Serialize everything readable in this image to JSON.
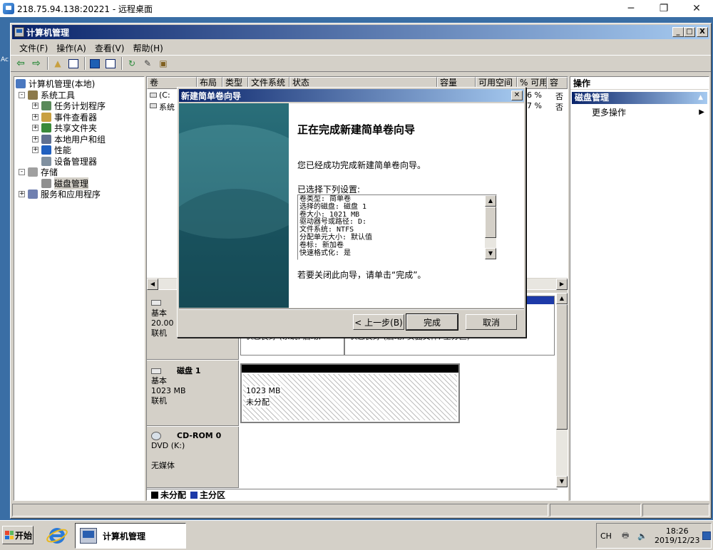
{
  "rdp": {
    "title": "218.75.94.138:20221 - 远程桌面",
    "minimize": "─",
    "maximize": "❐",
    "close": "✕",
    "desktop_label": "Ac"
  },
  "mmc": {
    "title": "计算机管理",
    "title_buttons": {
      "min": "_",
      "max": "□",
      "close": "X"
    },
    "menus": [
      "文件(F)",
      "操作(A)",
      "查看(V)",
      "帮助(H)"
    ],
    "toolbar_icons": [
      "back-arrow-icon",
      "forward-arrow-icon",
      "up-folder-icon",
      "show-hide-tree-icon",
      "help-icon",
      "properties-icon",
      "refresh-icon",
      "export-icon",
      "disk-icon"
    ]
  },
  "tree": [
    {
      "label": "计算机管理(本地)",
      "level": 0,
      "exp": "",
      "icon": "computer-icon",
      "color": "#4a78c0"
    },
    {
      "label": "系统工具",
      "level": 1,
      "exp": "-",
      "icon": "tools-icon",
      "color": "#8c7a4a"
    },
    {
      "label": "任务计划程序",
      "level": 2,
      "exp": "+",
      "icon": "clock-icon",
      "color": "#5a8a5a"
    },
    {
      "label": "事件查看器",
      "level": 2,
      "exp": "+",
      "icon": "event-viewer-icon",
      "color": "#c8a040"
    },
    {
      "label": "共享文件夹",
      "level": 2,
      "exp": "+",
      "icon": "shared-folder-icon",
      "color": "#3a8a3a"
    },
    {
      "label": "本地用户和组",
      "level": 2,
      "exp": "+",
      "icon": "users-icon",
      "color": "#607090"
    },
    {
      "label": "性能",
      "level": 2,
      "exp": "+",
      "icon": "performance-icon",
      "color": "#2060c0"
    },
    {
      "label": "设备管理器",
      "level": 2,
      "exp": "",
      "icon": "device-manager-icon",
      "color": "#8090a0"
    },
    {
      "label": "存储",
      "level": 1,
      "exp": "-",
      "icon": "storage-icon",
      "color": "#a0a0a0"
    },
    {
      "label": "磁盘管理",
      "level": 2,
      "exp": "",
      "icon": "disk-management-icon",
      "color": "#909090",
      "selected": true
    },
    {
      "label": "服务和应用程序",
      "level": 1,
      "exp": "+",
      "icon": "services-icon",
      "color": "#7080b0"
    }
  ],
  "volume_list": {
    "columns": [
      "卷",
      "布局",
      "类型",
      "文件系统",
      "状态",
      "容量",
      "可用空间",
      "% 可用",
      "容"
    ],
    "rows": [
      {
        "vol": "(C:",
        "pct": "6 %",
        "fault": "否"
      },
      {
        "vol": "系统",
        "pct": "7 %",
        "fault": "否"
      }
    ]
  },
  "disks": [
    {
      "name": "",
      "type": "基本",
      "size": "20.00",
      "status": "联机",
      "partition_text_1": "状态良好 (系统, 启动,",
      "partition_text_2": "状态良好 (启动, 页面文件, 主分区)"
    },
    {
      "name": "磁盘 1",
      "type": "基本",
      "size": "1023 MB",
      "status": "联机",
      "partition_size": "1023 MB",
      "partition_state": "未分配"
    },
    {
      "name": "CD-ROM 0",
      "type": "DVD (K:)",
      "size": "",
      "status": "无媒体"
    }
  ],
  "legend": [
    {
      "label": "未分配",
      "color": "#000000"
    },
    {
      "label": "主分区",
      "color": "#1d3aa8"
    }
  ],
  "actions": {
    "title": "操作",
    "section": "磁盘管理",
    "section_arrow": "▲",
    "item": "更多操作",
    "item_arrow": "▶"
  },
  "wizard": {
    "title": "新建简单卷向导",
    "close": "✕",
    "heading": "正在完成新建简单卷向导",
    "intro": "您已经成功完成新建简单卷向导。",
    "settings_label": "已选择下列设置:",
    "settings": [
      "卷类型: 简单卷",
      "选择的磁盘: 磁盘 1",
      "卷大小: 1021 MB",
      "驱动器号或路径: D:",
      "文件系统: NTFS",
      "分配单元大小: 默认值",
      "卷标: 新加卷",
      "快速格式化: 是"
    ],
    "finish_note": "若要关闭此向导，请单击“完成”。",
    "back_button": "< 上一步(B)",
    "finish_button": "完成",
    "cancel_button": "取消"
  },
  "taskbar": {
    "start": "开始",
    "task": "计算机管理",
    "lang": "CH",
    "time": "18:26",
    "date": "2019/12/23"
  }
}
